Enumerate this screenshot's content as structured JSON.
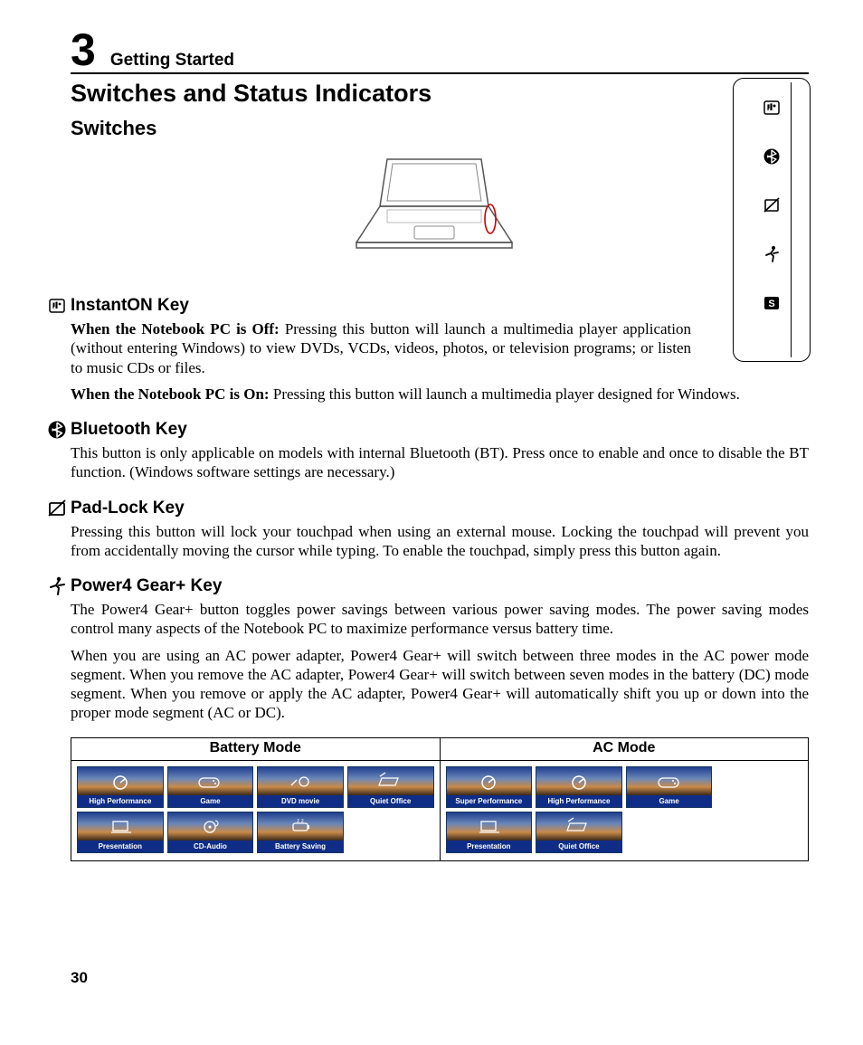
{
  "chapter": {
    "number": "3",
    "title": "Getting Started"
  },
  "section_title": "Switches and Status Indicators",
  "subsection": "Switches",
  "keys": {
    "instanton": {
      "title": "InstantON Key",
      "off_label": "When the Notebook PC is Off:",
      "off_text": " Pressing this button will launch a multimedia player application (without entering Windows) to view DVDs, VCDs, videos, photos, or television programs; or listen to music CDs or files.",
      "on_label": "When the Notebook PC is On:",
      "on_text": " Pressing this button will launch a multimedia player designed for Windows."
    },
    "bluetooth": {
      "title": "Bluetooth Key",
      "text": "This button is only applicable on models with internal Bluetooth (BT). Press once to enable and once to disable the BT function. (Windows software settings are necessary.)"
    },
    "padlock": {
      "title": "Pad-Lock Key",
      "text": "Pressing this button will lock your touchpad when using an external mouse. Locking the touchpad will prevent you from accidentally moving the cursor while typing. To enable the touchpad, simply press this button again."
    },
    "power4": {
      "title": "Power4 Gear+ Key",
      "p1": "The Power4 Gear+ button toggles power savings between various power saving modes. The power saving modes control many aspects of the Notebook PC to maximize performance versus battery time.",
      "p2": "When you are using an AC power adapter, Power4 Gear+ will switch between three modes in the AC power mode segment. When you remove the AC adapter, Power4 Gear+ will switch between seven modes in the battery (DC) mode segment. When you remove or apply the AC adapter, Power4 Gear+ will automatically shift you up or down into the proper mode segment (AC or DC)."
    }
  },
  "modes": {
    "battery": {
      "header": "Battery Mode",
      "tiles": [
        "High Performance",
        "Game",
        "DVD movie",
        "Quiet Office",
        "Presentation",
        "CD-Audio",
        "Battery Saving"
      ]
    },
    "ac": {
      "header": "AC Mode",
      "tiles": [
        "Super Performance",
        "High Performance",
        "Game",
        "",
        "Presentation",
        "Quiet Office"
      ]
    }
  },
  "page_number": "30",
  "side_icons": [
    "media-icon",
    "bluetooth-icon",
    "padlock-icon",
    "runner-icon",
    "s-key-icon"
  ]
}
